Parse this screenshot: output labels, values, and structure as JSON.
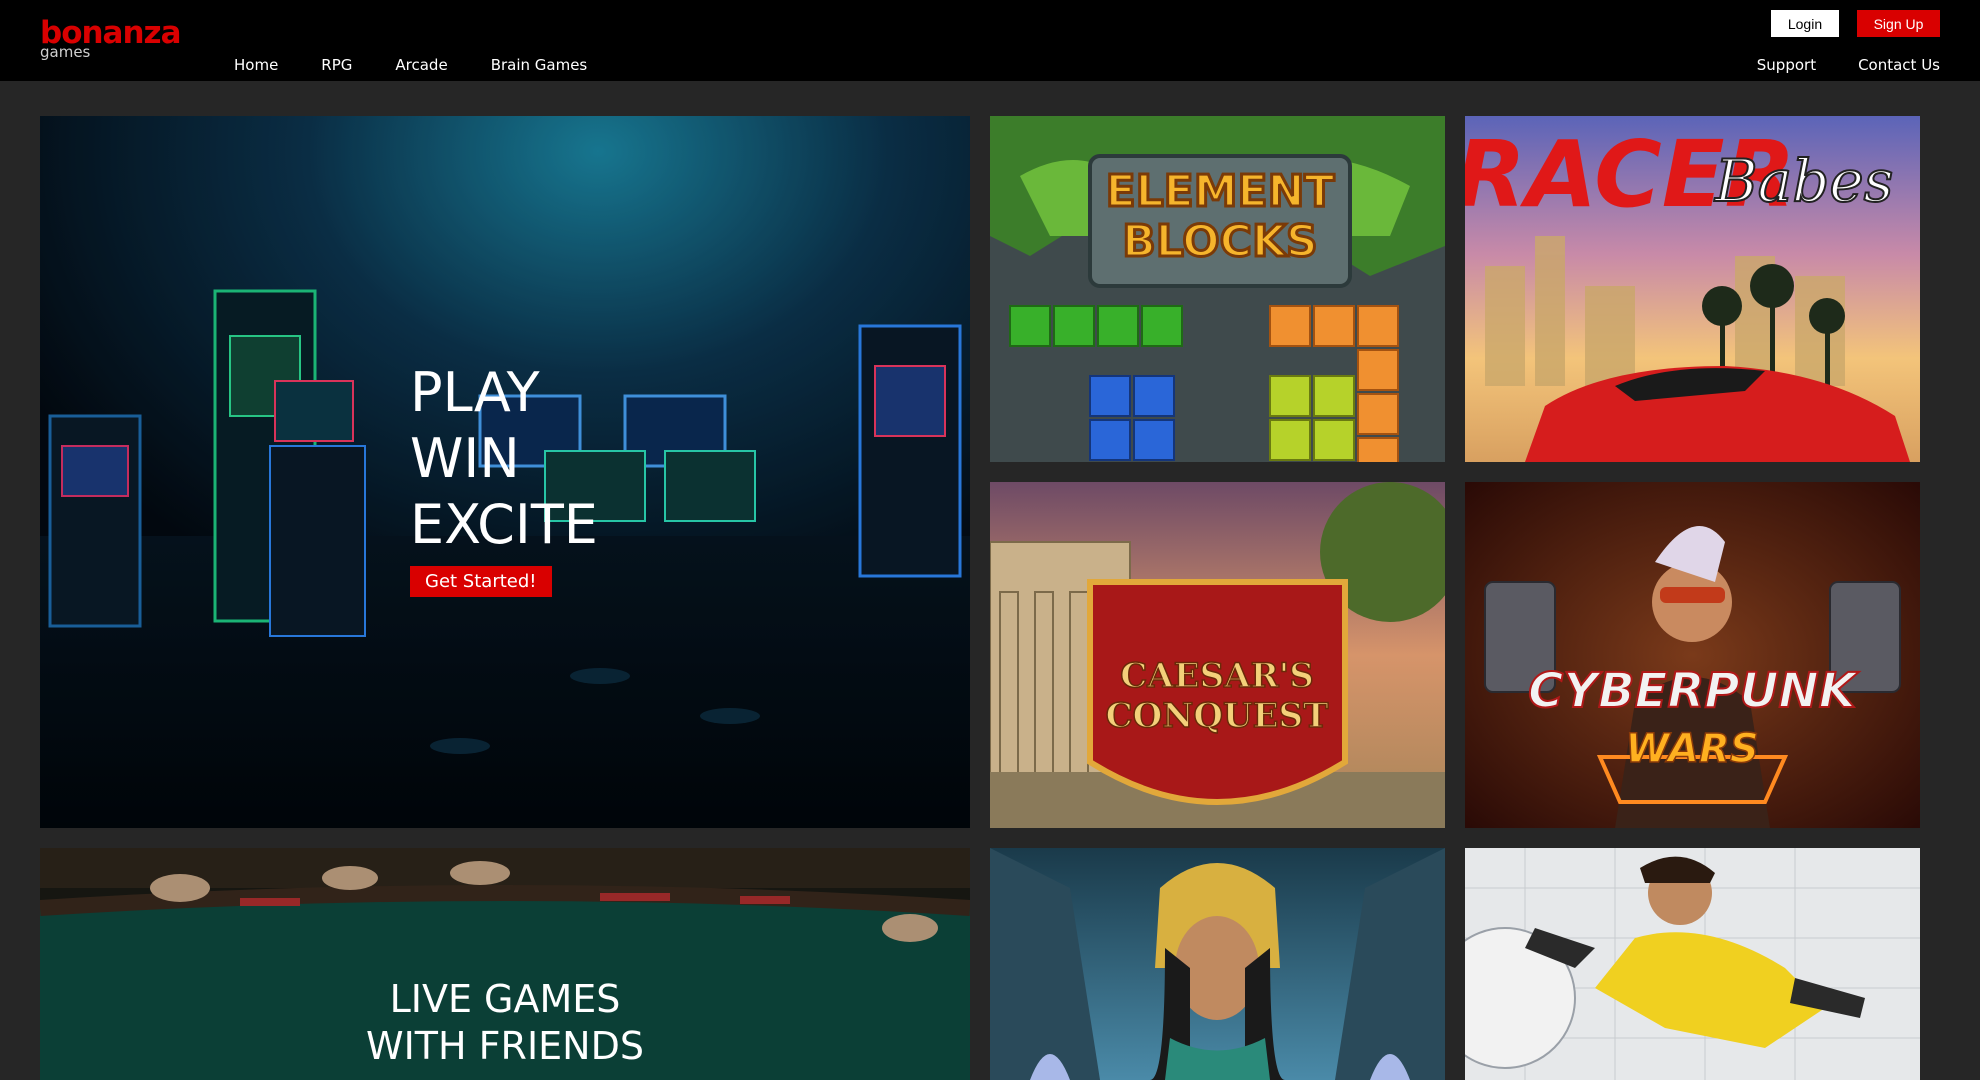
{
  "brand": {
    "name": "bonanza",
    "sub": "games"
  },
  "nav": {
    "left": [
      "Home",
      "RPG",
      "Arcade",
      "Brain Games"
    ],
    "right": [
      "Support",
      "Contact Us"
    ]
  },
  "auth": {
    "login": "Login",
    "signup": "Sign Up"
  },
  "hero": {
    "lines": [
      "PLAY",
      "WIN",
      "EXCITE"
    ],
    "cta": "Get Started!"
  },
  "live": {
    "lines": [
      "LIVE GAMES",
      "WITH FRIENDS"
    ]
  },
  "games": [
    {
      "title_line1": "ELEMENT",
      "title_line2": "BLOCKS"
    },
    {
      "title_line1": "RACER",
      "title_line2": "Babes"
    },
    {
      "title_line1": "CAESAR'S",
      "title_line2": "CONQUEST"
    },
    {
      "title_line1": "CYBERPUNK",
      "title_line2": "WARS"
    }
  ],
  "colors": {
    "accent": "#d90000",
    "header": "#000000",
    "background": "#262626"
  }
}
